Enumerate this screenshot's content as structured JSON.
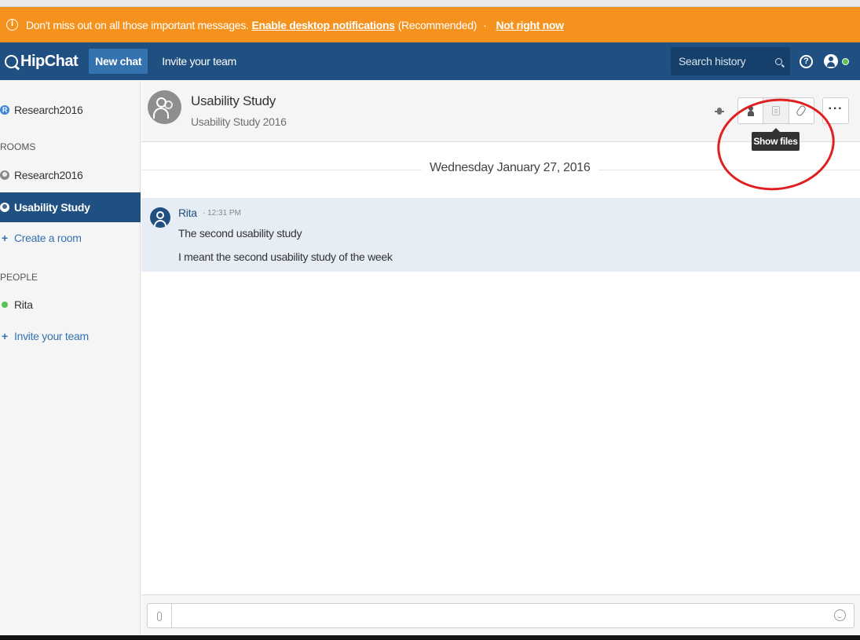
{
  "banner": {
    "message": "Don't miss out on all those important messages.",
    "enable_link": "Enable desktop notifications",
    "recommended": "(Recommended)",
    "separator": "·",
    "dismiss_link": "Not right now"
  },
  "header": {
    "logo": "HipChat",
    "new_chat": "New chat",
    "invite": "Invite your team",
    "search_placeholder": "Search history",
    "status": "online"
  },
  "sidebar": {
    "top_item": {
      "badge": "R",
      "label": "Research2016"
    },
    "rooms_heading": "ROOMS",
    "rooms": [
      {
        "label": "Research2016"
      },
      {
        "label": "Usability Study"
      }
    ],
    "create_room": "Create a room",
    "people_heading": "PEOPLE",
    "people": [
      {
        "label": "Rita"
      }
    ],
    "invite_team": "Invite your team"
  },
  "room": {
    "title": "Usability Study",
    "topic": "Usability Study 2016",
    "more_label": "···",
    "tooltip": "Show files"
  },
  "chat": {
    "date": "Wednesday January 27, 2016",
    "messages": [
      {
        "sender": "Rita",
        "time": "· 12:31 PM",
        "lines": [
          "The second usability study",
          "I meant the second usability study of the week"
        ]
      }
    ]
  },
  "colors": {
    "banner": "#f5921e",
    "header": "#205081",
    "active_room": "#205081",
    "message_highlight": "#e6edf4",
    "annotation": "#e02020"
  },
  "icons": {
    "banner": "info-icon",
    "search": "search-icon",
    "help": "help-icon",
    "user": "user-avatar-icon",
    "room_toolbar": [
      "bug-icon",
      "person-icon",
      "file-icon",
      "link-icon",
      "more-icon"
    ],
    "composer": [
      "paperclip-icon",
      "emoji-icon"
    ]
  }
}
